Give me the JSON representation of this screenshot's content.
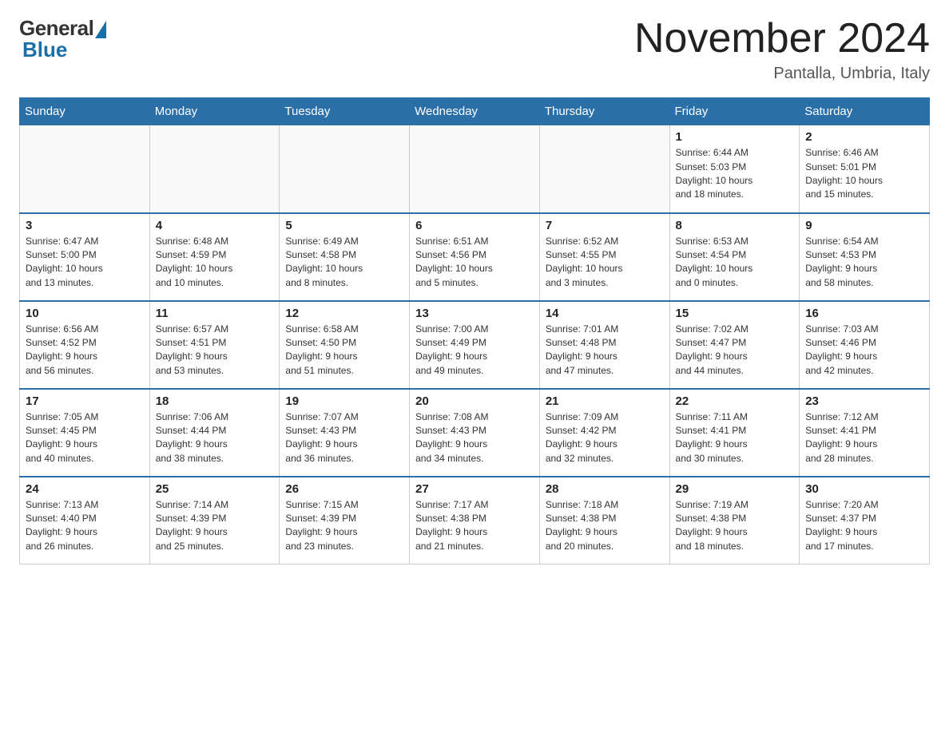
{
  "logo": {
    "general": "General",
    "blue": "Blue"
  },
  "header": {
    "month_year": "November 2024",
    "location": "Pantalla, Umbria, Italy"
  },
  "weekdays": [
    "Sunday",
    "Monday",
    "Tuesday",
    "Wednesday",
    "Thursday",
    "Friday",
    "Saturday"
  ],
  "weeks": [
    [
      {
        "day": "",
        "info": ""
      },
      {
        "day": "",
        "info": ""
      },
      {
        "day": "",
        "info": ""
      },
      {
        "day": "",
        "info": ""
      },
      {
        "day": "",
        "info": ""
      },
      {
        "day": "1",
        "info": "Sunrise: 6:44 AM\nSunset: 5:03 PM\nDaylight: 10 hours\nand 18 minutes."
      },
      {
        "day": "2",
        "info": "Sunrise: 6:46 AM\nSunset: 5:01 PM\nDaylight: 10 hours\nand 15 minutes."
      }
    ],
    [
      {
        "day": "3",
        "info": "Sunrise: 6:47 AM\nSunset: 5:00 PM\nDaylight: 10 hours\nand 13 minutes."
      },
      {
        "day": "4",
        "info": "Sunrise: 6:48 AM\nSunset: 4:59 PM\nDaylight: 10 hours\nand 10 minutes."
      },
      {
        "day": "5",
        "info": "Sunrise: 6:49 AM\nSunset: 4:58 PM\nDaylight: 10 hours\nand 8 minutes."
      },
      {
        "day": "6",
        "info": "Sunrise: 6:51 AM\nSunset: 4:56 PM\nDaylight: 10 hours\nand 5 minutes."
      },
      {
        "day": "7",
        "info": "Sunrise: 6:52 AM\nSunset: 4:55 PM\nDaylight: 10 hours\nand 3 minutes."
      },
      {
        "day": "8",
        "info": "Sunrise: 6:53 AM\nSunset: 4:54 PM\nDaylight: 10 hours\nand 0 minutes."
      },
      {
        "day": "9",
        "info": "Sunrise: 6:54 AM\nSunset: 4:53 PM\nDaylight: 9 hours\nand 58 minutes."
      }
    ],
    [
      {
        "day": "10",
        "info": "Sunrise: 6:56 AM\nSunset: 4:52 PM\nDaylight: 9 hours\nand 56 minutes."
      },
      {
        "day": "11",
        "info": "Sunrise: 6:57 AM\nSunset: 4:51 PM\nDaylight: 9 hours\nand 53 minutes."
      },
      {
        "day": "12",
        "info": "Sunrise: 6:58 AM\nSunset: 4:50 PM\nDaylight: 9 hours\nand 51 minutes."
      },
      {
        "day": "13",
        "info": "Sunrise: 7:00 AM\nSunset: 4:49 PM\nDaylight: 9 hours\nand 49 minutes."
      },
      {
        "day": "14",
        "info": "Sunrise: 7:01 AM\nSunset: 4:48 PM\nDaylight: 9 hours\nand 47 minutes."
      },
      {
        "day": "15",
        "info": "Sunrise: 7:02 AM\nSunset: 4:47 PM\nDaylight: 9 hours\nand 44 minutes."
      },
      {
        "day": "16",
        "info": "Sunrise: 7:03 AM\nSunset: 4:46 PM\nDaylight: 9 hours\nand 42 minutes."
      }
    ],
    [
      {
        "day": "17",
        "info": "Sunrise: 7:05 AM\nSunset: 4:45 PM\nDaylight: 9 hours\nand 40 minutes."
      },
      {
        "day": "18",
        "info": "Sunrise: 7:06 AM\nSunset: 4:44 PM\nDaylight: 9 hours\nand 38 minutes."
      },
      {
        "day": "19",
        "info": "Sunrise: 7:07 AM\nSunset: 4:43 PM\nDaylight: 9 hours\nand 36 minutes."
      },
      {
        "day": "20",
        "info": "Sunrise: 7:08 AM\nSunset: 4:43 PM\nDaylight: 9 hours\nand 34 minutes."
      },
      {
        "day": "21",
        "info": "Sunrise: 7:09 AM\nSunset: 4:42 PM\nDaylight: 9 hours\nand 32 minutes."
      },
      {
        "day": "22",
        "info": "Sunrise: 7:11 AM\nSunset: 4:41 PM\nDaylight: 9 hours\nand 30 minutes."
      },
      {
        "day": "23",
        "info": "Sunrise: 7:12 AM\nSunset: 4:41 PM\nDaylight: 9 hours\nand 28 minutes."
      }
    ],
    [
      {
        "day": "24",
        "info": "Sunrise: 7:13 AM\nSunset: 4:40 PM\nDaylight: 9 hours\nand 26 minutes."
      },
      {
        "day": "25",
        "info": "Sunrise: 7:14 AM\nSunset: 4:39 PM\nDaylight: 9 hours\nand 25 minutes."
      },
      {
        "day": "26",
        "info": "Sunrise: 7:15 AM\nSunset: 4:39 PM\nDaylight: 9 hours\nand 23 minutes."
      },
      {
        "day": "27",
        "info": "Sunrise: 7:17 AM\nSunset: 4:38 PM\nDaylight: 9 hours\nand 21 minutes."
      },
      {
        "day": "28",
        "info": "Sunrise: 7:18 AM\nSunset: 4:38 PM\nDaylight: 9 hours\nand 20 minutes."
      },
      {
        "day": "29",
        "info": "Sunrise: 7:19 AM\nSunset: 4:38 PM\nDaylight: 9 hours\nand 18 minutes."
      },
      {
        "day": "30",
        "info": "Sunrise: 7:20 AM\nSunset: 4:37 PM\nDaylight: 9 hours\nand 17 minutes."
      }
    ]
  ]
}
